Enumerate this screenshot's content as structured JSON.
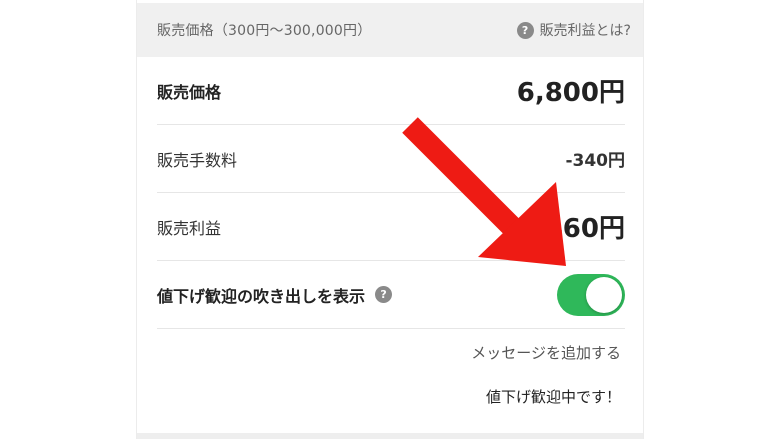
{
  "section": {
    "title": "販売価格（300円〜300,000円）",
    "help_label": "販売利益とは?"
  },
  "rows": {
    "price": {
      "label": "販売価格",
      "value": "6,800円"
    },
    "fee": {
      "label": "販売手数料",
      "value": "-340円"
    },
    "profit": {
      "label": "販売利益",
      "value": "460円"
    }
  },
  "toggle": {
    "label": "値下げ歓迎の吹き出しを表示",
    "state": "on",
    "on_color": "#2fb85a"
  },
  "message": {
    "add_label": "メッセージを追加する",
    "text": "値下げ歓迎中です！"
  },
  "annotation": {
    "arrow_color": "#ee1b14",
    "icon": "red-arrow-icon"
  }
}
